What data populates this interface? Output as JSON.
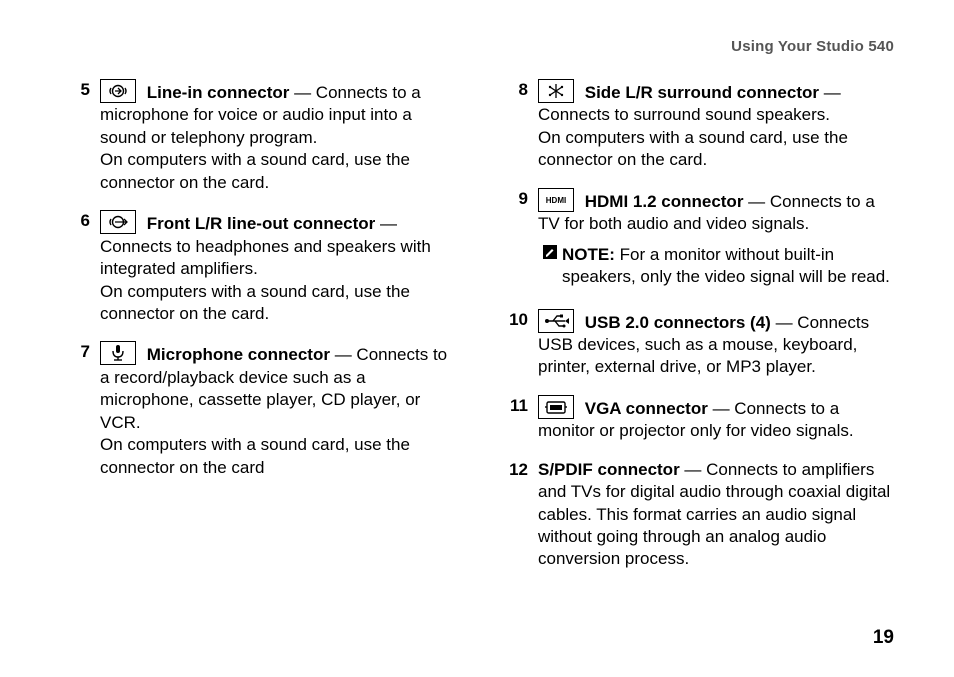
{
  "header": "Using Your Studio 540",
  "page_number": "19",
  "left": [
    {
      "num": "5",
      "icon": "line-in-icon",
      "title": "Line-in connector",
      "desc1": " — Connects to a microphone for voice or audio input into a sound or telephony program.",
      "desc2": "On computers with a sound card, use the connector on the card."
    },
    {
      "num": "6",
      "icon": "line-out-front-icon",
      "title": "Front L/R line-out connector",
      "desc1": " — Connects to headphones and speakers with integrated amplifiers.",
      "desc2": "On computers with a sound card, use the connector on the card."
    },
    {
      "num": "7",
      "icon": "microphone-icon",
      "title": "Microphone connector",
      "desc1": " — Connects to a record/playback device such as a microphone, cassette player, CD player, or VCR.",
      "desc2": "On computers with a sound card, use the connector on the card"
    }
  ],
  "right": [
    {
      "num": "8",
      "icon": "side-surround-icon",
      "title": "Side L/R surround connector",
      "desc1": " — Connects to surround sound speakers.",
      "desc2": "On computers with a sound card, use the connector on the card."
    },
    {
      "num": "9",
      "icon": "hdmi-icon",
      "title": "HDMI 1.2 connector",
      "desc1": " — Connects to a TV for both audio and video signals.",
      "note_label": "NOTE:",
      "note_text": " For a monitor without built-in speakers, only the video signal will be read."
    },
    {
      "num": "10",
      "icon": "usb-icon",
      "title": "USB 2.0 connectors (4)",
      "desc1": " — Connects USB devices, such as a mouse, keyboard, printer, external drive, or MP3 player."
    },
    {
      "num": "11",
      "icon": "vga-icon",
      "title": "VGA connector",
      "desc1": " — Connects to a monitor or projector only for video signals."
    },
    {
      "num": "12",
      "icon": "",
      "title": "S/PDIF connector",
      "desc1": " — Connects to amplifiers and TVs for digital audio through coaxial digital cables. This format carries an audio signal without going through an analog audio conversion process."
    }
  ]
}
